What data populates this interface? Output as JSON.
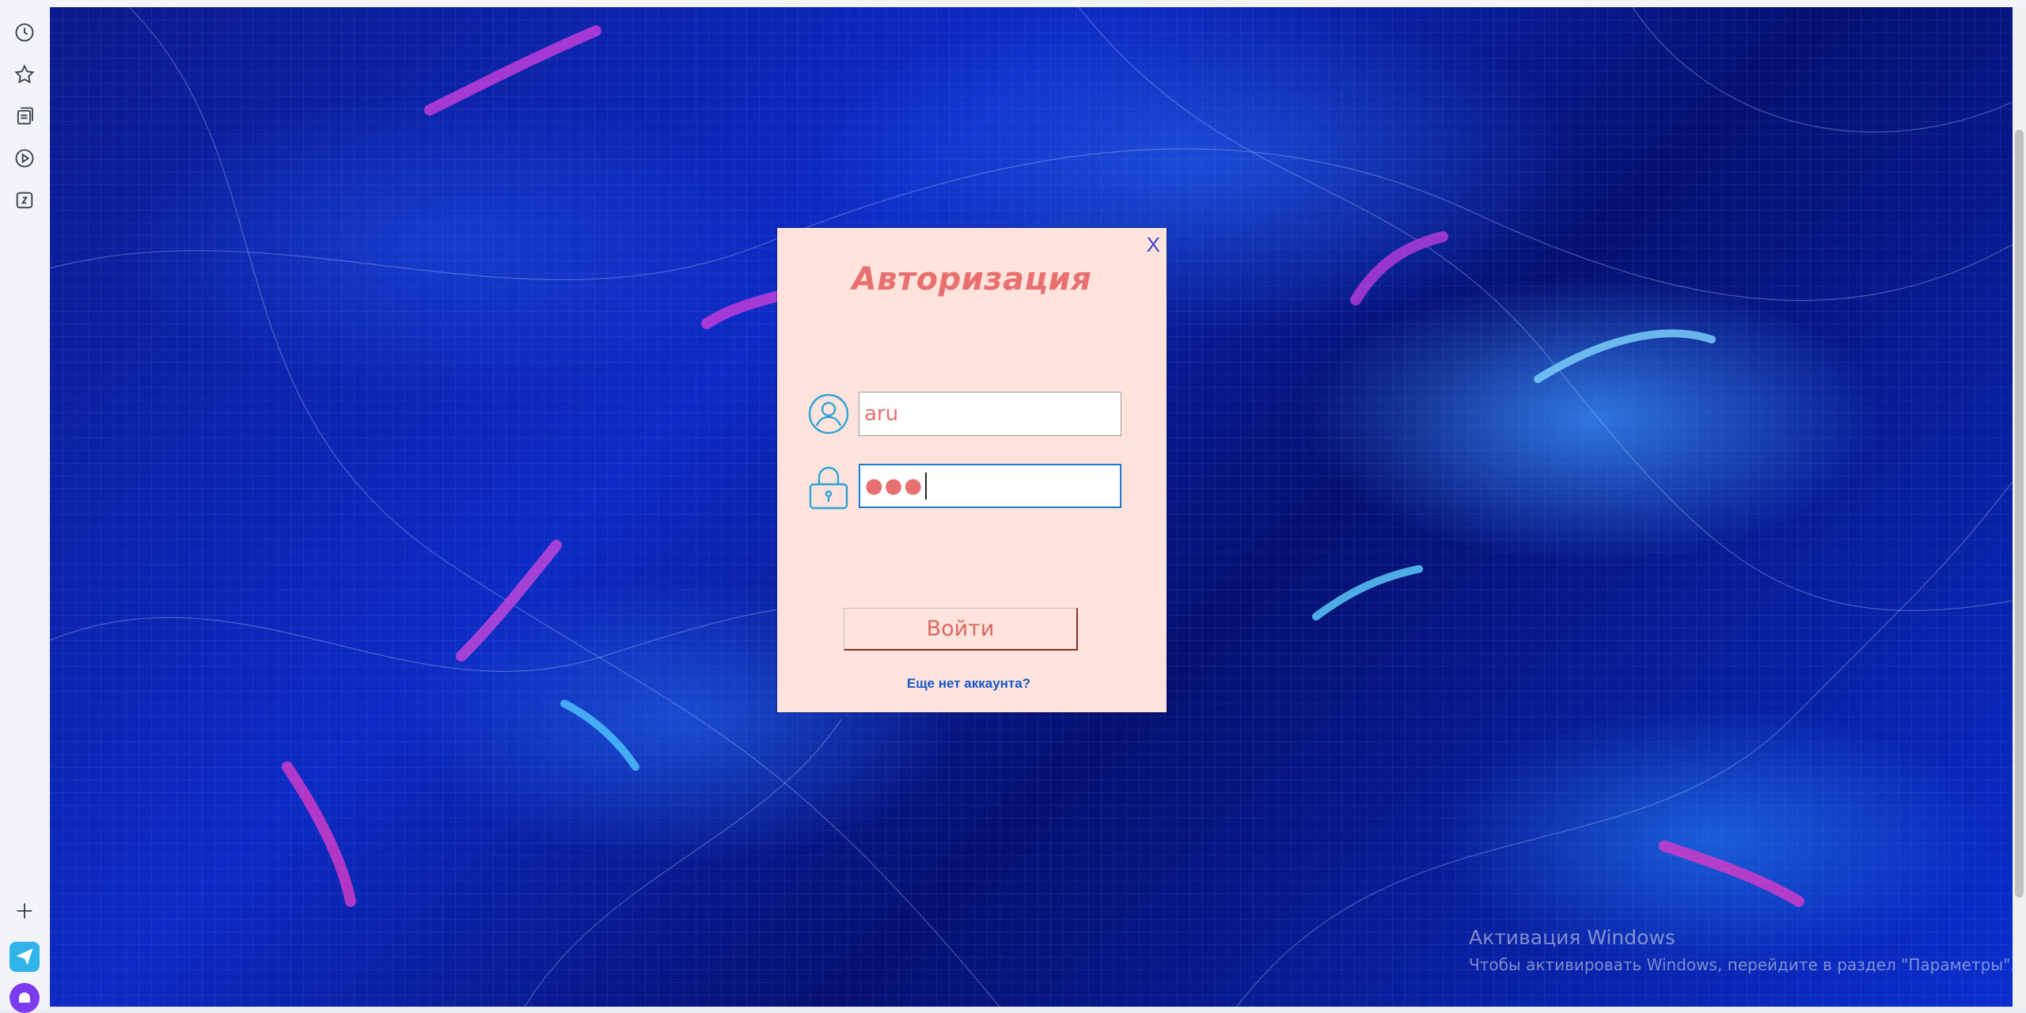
{
  "sidebar": {
    "icons": [
      "history-icon",
      "bookmarks-star-icon",
      "collections-icon",
      "play-video-icon",
      "zen-icon",
      "add-icon",
      "send-app-icon",
      "alice-app-icon"
    ]
  },
  "login": {
    "close_label": "X",
    "title": "Авторизация",
    "username_value": "aru",
    "password_mask": "●●●",
    "submit_label": "Войти",
    "register_link": "Еще нет аккаунта?"
  },
  "watermark": {
    "title": "Активация Windows",
    "subtitle": "Чтобы активировать Windows, перейдите в раздел \"Параметры\"."
  },
  "colors": {
    "dialog_bg": "#ffe3dc",
    "title_color": "#e8706f",
    "link_color": "#1457c8",
    "icon_color": "#2ea3d6"
  }
}
